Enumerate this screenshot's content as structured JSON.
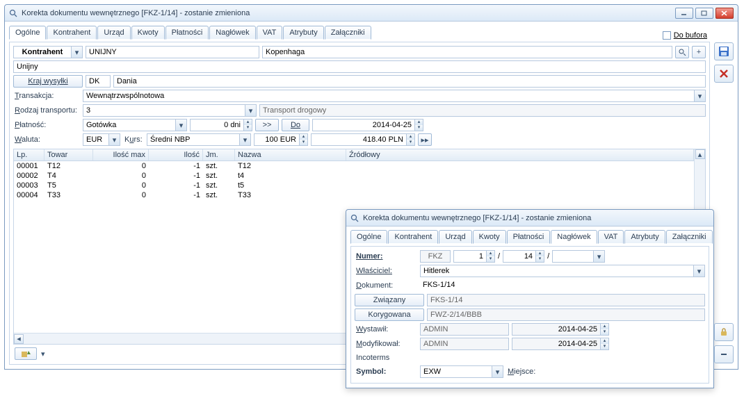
{
  "mainWindow": {
    "title": "Korekta dokumentu wewnętrznego [FKZ-1/14]  - zostanie zmieniona",
    "tabs": [
      "Ogólne",
      "Kontrahent",
      "Urząd",
      "Kwoty",
      "Płatności",
      "Nagłówek",
      "VAT",
      "Atrybuty",
      "Załączniki"
    ],
    "activeTab": 0,
    "doBuforaLabel": "Do bufora",
    "kontrahentBtn": "Kontrahent",
    "kontrahentCode": "UNIJNY",
    "kontrahentCity": "Kopenhaga",
    "kontrahentDesc": "Unijny",
    "krajBtn": "Kraj wysyłki",
    "krajCode": "DK",
    "krajName": "Dania",
    "transakcjaLabel": "Transakcja:",
    "transakcjaValue": "Wewnątrzwspólnotowa",
    "rodzajTransLabel": "Rodzaj transportu:",
    "rodzajTransValue": "3",
    "rodzajTransPlaceholder": "Transport drogowy",
    "platnoscLabel": "Płatność:",
    "platnoscValue": "Gotówka",
    "platnoscDni": "0 dni",
    "arrowBtn": ">>",
    "doBtn": "Do",
    "platnoscDate": "2014-04-25",
    "walutaLabel": "Waluta:",
    "walutaValue": "EUR",
    "kursLabel": "Kurs:",
    "kursType": "Średni NBP",
    "kursEur": "100 EUR",
    "kursPln": "418.40 PLN",
    "grid": {
      "headers": {
        "lp": "Lp.",
        "towar": "Towar",
        "max": "Ilość max",
        "ilosc": "Ilość",
        "jm": "Jm.",
        "nazwa": "Nazwa",
        "src": "Źródłowy"
      },
      "rows": [
        {
          "lp": "00001",
          "towar": "T12",
          "max": "0",
          "ilosc": "-1",
          "jm": "szt.",
          "nazwa": "T12"
        },
        {
          "lp": "00002",
          "towar": "T4",
          "max": "0",
          "ilosc": "-1",
          "jm": "szt.",
          "nazwa": "t4"
        },
        {
          "lp": "00003",
          "towar": "T5",
          "max": "0",
          "ilosc": "-1",
          "jm": "szt.",
          "nazwa": "t5"
        },
        {
          "lp": "00004",
          "towar": "T33",
          "max": "0",
          "ilosc": "-1",
          "jm": "szt.",
          "nazwa": "T33"
        }
      ]
    }
  },
  "secondWindow": {
    "title": "Korekta dokumentu wewnętrznego [FKZ-1/14]  - zostanie zmieniona",
    "tabs": [
      "Ogólne",
      "Kontrahent",
      "Urząd",
      "Kwoty",
      "Płatności",
      "Nagłówek",
      "VAT",
      "Atrybuty",
      "Załączniki"
    ],
    "activeTab": 5,
    "numerLabel": "Numer:",
    "numerPrefix": "FKZ",
    "numerA": "1",
    "numerB": "14",
    "slash": "/",
    "wlascicielLabel": "Właściciel:",
    "wlascicielValue": "Hitlerek",
    "dokumentLabel": "Dokument:",
    "dokumentValue": "FKS-1/14",
    "zwiazanyBtn": "Związany",
    "zwiazanyValue": "FKS-1/14",
    "korygowanaBtn": "Korygowana",
    "korygowanaValue": "FWZ-2/14/BBB",
    "wystawilLabel": "Wystawił:",
    "wystawilValue": "ADMIN",
    "wystawilDate": "2014-04-25",
    "modyfLabel": "Modyfikował:",
    "modyfValue": "ADMIN",
    "modyfDate": "2014-04-25",
    "incotermsLabel": "Incoterms",
    "symbolLabel": "Symbol:",
    "symbolValue": "EXW",
    "miejsceLabel": "Miejsce:"
  }
}
